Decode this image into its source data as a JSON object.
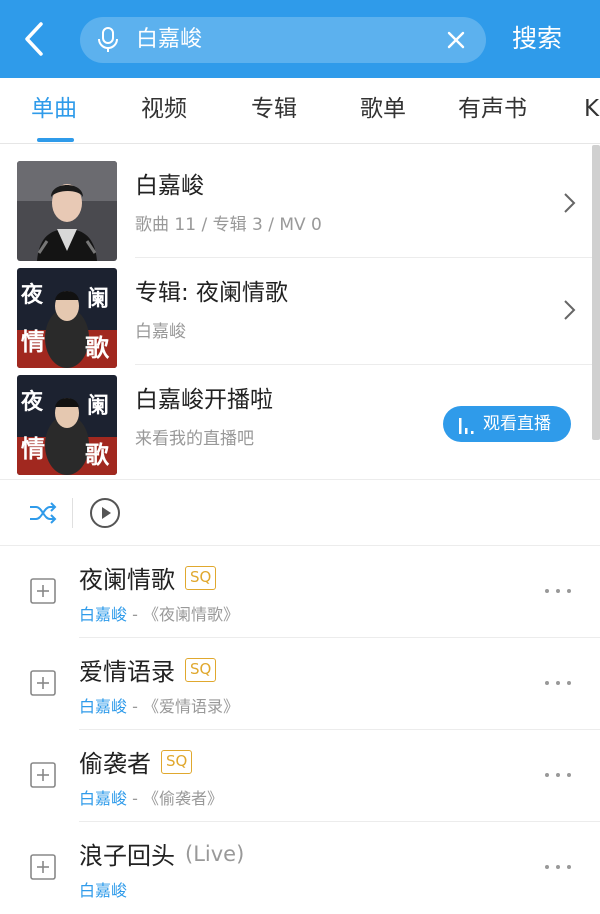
{
  "header": {
    "search_value": "白嘉峻",
    "search_button": "搜索"
  },
  "tabs": [
    {
      "label": "单曲",
      "active": true
    },
    {
      "label": "视频"
    },
    {
      "label": "专辑"
    },
    {
      "label": "歌单"
    },
    {
      "label": "有声书"
    },
    {
      "label": "K"
    }
  ],
  "top_results": [
    {
      "title": "白嘉峻",
      "subtitle": "歌曲 11 / 专辑 3 / MV 0"
    },
    {
      "title": "专辑: 夜阑情歌",
      "subtitle": "白嘉峻",
      "cover_text": [
        "夜",
        "阑",
        "情",
        "歌"
      ]
    },
    {
      "title": "白嘉峻开播啦",
      "subtitle": "来看我的直播吧",
      "button": "观看直播",
      "cover_text": [
        "夜",
        "阑",
        "情",
        "歌"
      ]
    }
  ],
  "songs": [
    {
      "title": "夜阑情歌",
      "badge": "SQ",
      "artist": "白嘉峻",
      "album": " - 《夜阑情歌》"
    },
    {
      "title": "爱情语录",
      "badge": "SQ",
      "artist": "白嘉峻",
      "album": " - 《爱情语录》"
    },
    {
      "title": "偷袭者",
      "badge": "SQ",
      "artist": "白嘉峻",
      "album": " - 《偷袭者》"
    },
    {
      "title": "浪子回头",
      "tag": "(Live)",
      "artist": "白嘉峻",
      "album": ""
    }
  ],
  "colors": {
    "accent": "#2f9bea",
    "sq_badge": "#e0a82e",
    "muted_text": "#999999"
  }
}
